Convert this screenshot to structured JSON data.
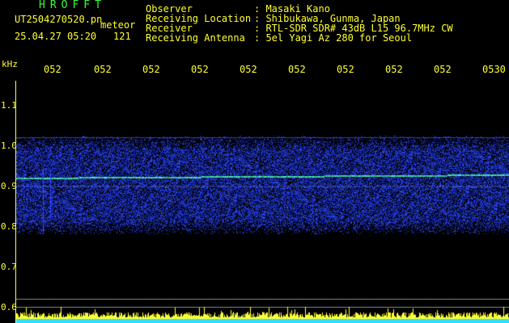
{
  "header": {
    "brand": "HROFFT",
    "filename": "UT2504270520.pn",
    "mode": "meteor",
    "datetime": "25.04.27 05:20",
    "count": "121"
  },
  "info": [
    {
      "label": "Observer",
      "value": ": Masaki Kano"
    },
    {
      "label": "Receiving Location",
      "value": ": Shibukawa, Gunma, Japan"
    },
    {
      "label": "Receiver",
      "value": ": RTL-SDR SDR# 43dB L15 96.7MHz CW"
    },
    {
      "label": "Receiving Antenna",
      "value": ": 5el Yagi Az 280 for Seoul"
    }
  ],
  "axis": {
    "unit": "kHz",
    "y_ticks": [
      "1.1",
      "1.0",
      "0.9",
      "0.8",
      "0.7",
      "0.6"
    ],
    "x_ticks": [
      "052",
      "052",
      "052",
      "052",
      "052",
      "052",
      "052",
      "052",
      "052",
      "0530"
    ]
  },
  "colors": {
    "label": "#ffff33",
    "brand": "#33ff33",
    "noise": "#1a2aff",
    "carrier": "#66ffcc",
    "baseline": "#33ddff"
  }
}
